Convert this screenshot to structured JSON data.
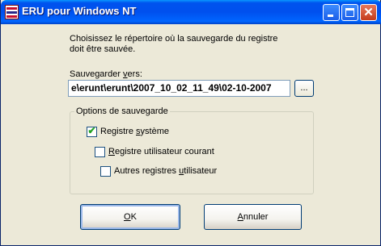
{
  "window": {
    "title": "ERU pour Windows NT",
    "app_icon": "eru-app-icon"
  },
  "titlebar_buttons": {
    "minimize": "minimize-icon",
    "maximize": "maximize-icon",
    "close": "close-icon",
    "close_glyph": "✕"
  },
  "intro": {
    "line1": "Choisissez le répertoire où la sauvegarde du registre",
    "line2": "doit être sauvée."
  },
  "save_to": {
    "label_pre": "Sauvegarder ",
    "label_ul": "v",
    "label_post": "ers:",
    "path_value": "e\\erunt\\erunt\\2007_10_02_11_49\\02-10-2007",
    "browse_label": "..."
  },
  "options": {
    "group_title": "Options de sauvegarde",
    "items": [
      {
        "pre": "Registre ",
        "ul": "s",
        "post": "ystème",
        "checked": true
      },
      {
        "pre": "",
        "ul": "R",
        "post": "egistre utilisateur courant",
        "checked": false
      },
      {
        "pre": "Autres registres ",
        "ul": "u",
        "post": "tilisateur",
        "checked": false
      }
    ]
  },
  "buttons": {
    "ok": {
      "ul": "O",
      "post": "K"
    },
    "cancel": {
      "ul": "A",
      "post": "nnuler"
    }
  },
  "colors": {
    "titlebar": "#0054e3",
    "dialog_bg": "#ece9d8",
    "checkmark": "#21a121"
  }
}
